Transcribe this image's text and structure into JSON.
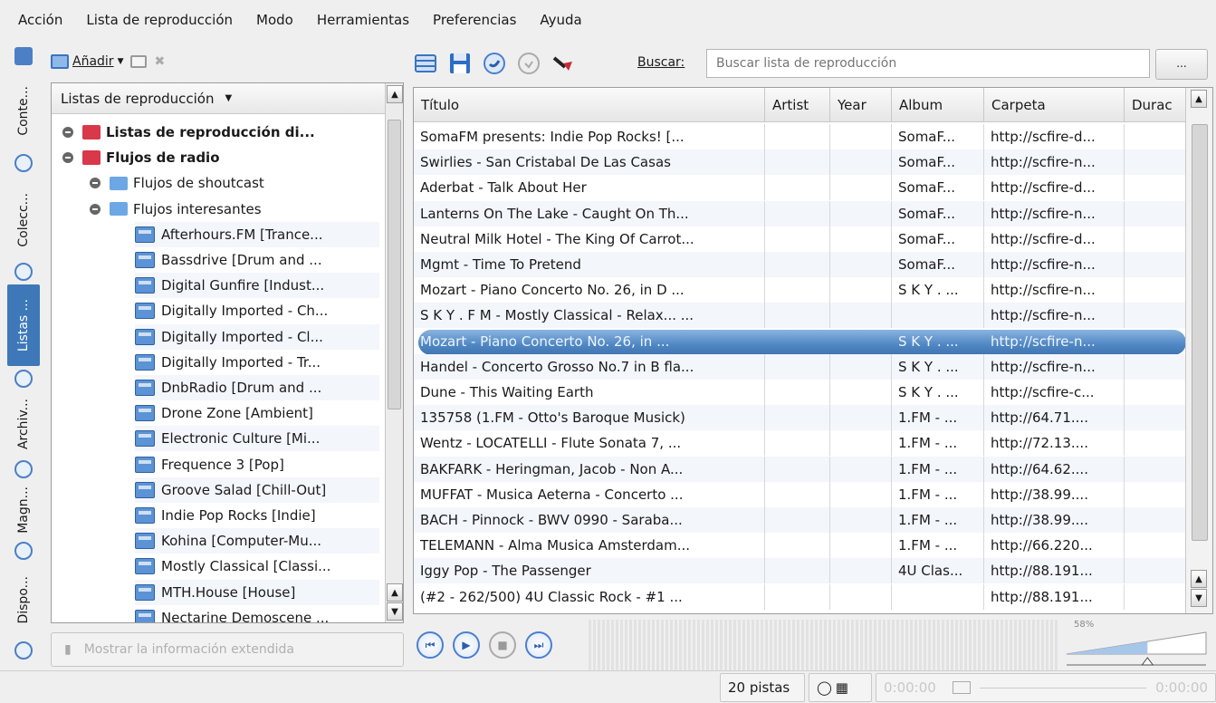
{
  "menubar": {
    "items": [
      "Acción",
      "Lista de reproducción",
      "Modo",
      "Herramientas",
      "Preferencias",
      "Ayuda"
    ]
  },
  "sidetabs": [
    "Conte...",
    "Colecc...",
    "Listas ...",
    "Archiv...",
    "Magn...",
    "Dispo..."
  ],
  "left_toolbar": {
    "add_label": "Añadir"
  },
  "tree": {
    "header": "Listas de reproducción",
    "rows": [
      {
        "label": "Listas de reproducción di...",
        "level": 0,
        "bold": true,
        "icon": "folder-red",
        "expander": true
      },
      {
        "label": "Flujos de radio",
        "level": 0,
        "bold": true,
        "icon": "folder-red",
        "expander": true
      },
      {
        "label": "Flujos de shoutcast",
        "level": 1,
        "bold": false,
        "icon": "folder-blue",
        "expander": true
      },
      {
        "label": "Flujos interesantes",
        "level": 1,
        "bold": false,
        "icon": "folder-blue",
        "expander": true
      },
      {
        "label": "Afterhours.FM [Trance...",
        "level": 2,
        "icon": "stream"
      },
      {
        "label": "Bassdrive [Drum and ...",
        "level": 2,
        "icon": "stream"
      },
      {
        "label": "Digital Gunfire [Indust...",
        "level": 2,
        "icon": "stream"
      },
      {
        "label": "Digitally Imported - Ch...",
        "level": 2,
        "icon": "stream"
      },
      {
        "label": "Digitally Imported - Cl...",
        "level": 2,
        "icon": "stream"
      },
      {
        "label": "Digitally Imported - Tr...",
        "level": 2,
        "icon": "stream"
      },
      {
        "label": "DnbRadio [Drum and ...",
        "level": 2,
        "icon": "stream"
      },
      {
        "label": "Drone Zone [Ambient]",
        "level": 2,
        "icon": "stream"
      },
      {
        "label": "Electronic Culture [Mi...",
        "level": 2,
        "icon": "stream"
      },
      {
        "label": "Frequence 3 [Pop]",
        "level": 2,
        "icon": "stream"
      },
      {
        "label": "Groove Salad [Chill-Out]",
        "level": 2,
        "icon": "stream"
      },
      {
        "label": "Indie Pop Rocks [Indie]",
        "level": 2,
        "icon": "stream"
      },
      {
        "label": "Kohina [Computer-Mu...",
        "level": 2,
        "icon": "stream"
      },
      {
        "label": "Mostly Classical [Classi...",
        "level": 2,
        "icon": "stream"
      },
      {
        "label": "MTH.House [House]",
        "level": 2,
        "icon": "stream"
      },
      {
        "label": "Nectarine Demoscene ...",
        "level": 2,
        "icon": "stream"
      }
    ]
  },
  "extinfo_label": "Mostrar la información extendida",
  "search": {
    "label": "Buscar:",
    "placeholder": "Buscar lista de reproducción",
    "more": "..."
  },
  "table": {
    "columns": [
      "Título",
      "Artist",
      "Year",
      "Album",
      "Carpeta",
      "Durac"
    ],
    "rows": [
      [
        "SomaFM presents: Indie Pop Rocks! [...",
        "",
        "",
        "SomaF...",
        "http://scfire-d...",
        ""
      ],
      [
        "Swirlies - San Cristabal De Las Casas",
        "",
        "",
        "SomaF...",
        "http://scfire-n...",
        ""
      ],
      [
        "Aderbat - Talk About Her",
        "",
        "",
        "SomaF...",
        "http://scfire-d...",
        ""
      ],
      [
        "Lanterns On The Lake - Caught On Th...",
        "",
        "",
        "SomaF...",
        "http://scfire-n...",
        ""
      ],
      [
        "Neutral Milk Hotel - The King Of Carrot...",
        "",
        "",
        "SomaF...",
        "http://scfire-d...",
        ""
      ],
      [
        "Mgmt - Time To Pretend",
        "",
        "",
        "SomaF...",
        "http://scfire-n...",
        ""
      ],
      [
        "Mozart - Piano Concerto No. 26, in D ...",
        "",
        "",
        "S K Y . ...",
        "http://scfire-n...",
        ""
      ],
      [
        "S K Y . F M - Mostly Classical - Relax... ...",
        "",
        "",
        "",
        "http://scfire-n...",
        ""
      ],
      [
        "Mozart - Piano Concerto No. 26, in ...",
        "",
        "",
        "S K Y . ...",
        "http://scfire-n...",
        ""
      ],
      [
        "Handel - Concerto Grosso No.7 in B fla...",
        "",
        "",
        "S K Y . ...",
        "http://scfire-n...",
        ""
      ],
      [
        "Dune - This Waiting Earth",
        "",
        "",
        "S K Y . ...",
        "http://scfire-c...",
        ""
      ],
      [
        "135758 (1.FM - Otto's Baroque Musick)",
        "",
        "",
        "1.FM - ...",
        "http://64.71....",
        ""
      ],
      [
        "Wentz - LOCATELLI - Flute Sonata 7, ...",
        "",
        "",
        "1.FM - ...",
        "http://72.13....",
        ""
      ],
      [
        "BAKFARK  - Heringman, Jacob - Non A...",
        "",
        "",
        "1.FM - ...",
        "http://64.62....",
        ""
      ],
      [
        "MUFFAT - Musica Aeterna - Concerto ...",
        "",
        "",
        "1.FM - ...",
        "http://38.99....",
        ""
      ],
      [
        "BACH - Pinnock - BWV 0990 - Saraba...",
        "",
        "",
        "1.FM - ...",
        "http://38.99....",
        ""
      ],
      [
        "TELEMANN - Alma Musica Amsterdam...",
        "",
        "",
        "1.FM - ...",
        "http://66.220...",
        ""
      ],
      [
        "Iggy Pop - The Passenger",
        "",
        "",
        "4U Clas...",
        "http://88.191...",
        ""
      ],
      [
        "(#2 - 262/500) 4U Classic Rock - #1 ...",
        "",
        "",
        "",
        "http://88.191...",
        ""
      ]
    ],
    "selected_index": 8
  },
  "volume": {
    "percent_label": "58%",
    "level": 0.58
  },
  "status": {
    "tracks": "20 pistas",
    "time_elapsed": "0:00:00",
    "time_remaining": "0:00:00"
  },
  "colors": {
    "accent": "#3e78b8",
    "selection": "#4f86c3"
  }
}
